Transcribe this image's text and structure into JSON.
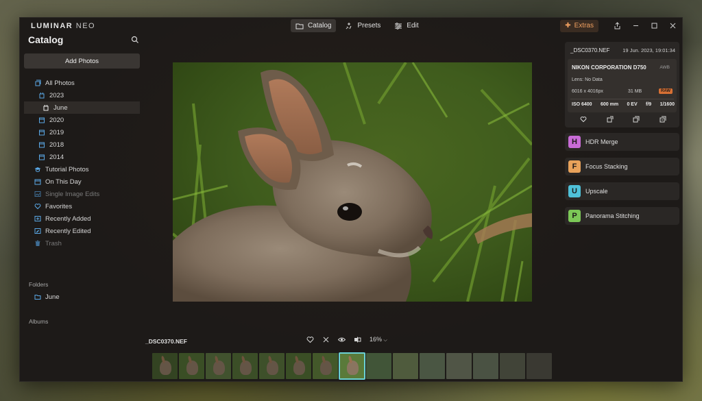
{
  "app": {
    "logo_main": "LUMINAR",
    "logo_sub": "NEO"
  },
  "modes": [
    {
      "label": "Catalog",
      "icon": "folder-icon",
      "active": true
    },
    {
      "label": "Presets",
      "icon": "sparkle-icon",
      "active": false
    },
    {
      "label": "Edit",
      "icon": "sliders-icon",
      "active": false
    }
  ],
  "window_controls": {
    "extras_label": "Extras"
  },
  "sidebar": {
    "title": "Catalog",
    "add_photos_label": "Add Photos",
    "items": [
      {
        "label": "All Photos",
        "icon": "photo-icon"
      },
      {
        "label": "2023",
        "icon": "calendar-folder-icon"
      },
      {
        "label": "June",
        "icon": "calendar-folder-icon"
      },
      {
        "label": "2020",
        "icon": "calendar-icon"
      },
      {
        "label": "2019",
        "icon": "calendar-icon"
      },
      {
        "label": "2018",
        "icon": "calendar-icon"
      },
      {
        "label": "2014",
        "icon": "calendar-icon"
      },
      {
        "label": "Tutorial Photos",
        "icon": "graduation-cap-icon"
      },
      {
        "label": "On This Day",
        "icon": "calendar-icon"
      },
      {
        "label": "Single Image Edits",
        "icon": "image-edit-icon"
      },
      {
        "label": "Favorites",
        "icon": "heart-icon"
      },
      {
        "label": "Recently Added",
        "icon": "recent-icon"
      },
      {
        "label": "Recently Edited",
        "icon": "recent-icon"
      },
      {
        "label": "Trash",
        "icon": "trash-icon"
      }
    ],
    "folders_label": "Folders",
    "folders": [
      {
        "label": "June",
        "icon": "folder-icon"
      }
    ],
    "albums_label": "Albums"
  },
  "viewer": {
    "filename": "_DSC0370.NEF",
    "zoom": "16%"
  },
  "info_panel": {
    "filename": "_DSC0370.NEF",
    "datetime": "19 Jun. 2023, 19:01:34",
    "camera": "NIKON CORPORATION D750",
    "white_balance": "AWB",
    "lens": "Lens: No Data",
    "resolution": "6016 x 4016px",
    "file_size": "31 MB",
    "format_badge": "RAW",
    "iso": "ISO 6400",
    "focal_length": "600 mm",
    "exposure_comp": "0 EV",
    "aperture": "f/9",
    "shutter": "1/1600"
  },
  "extensions": [
    {
      "letter": "H",
      "label": "HDR Merge",
      "color": "#c86bd6"
    },
    {
      "letter": "F",
      "label": "Focus Stacking",
      "color": "#e8a25a"
    },
    {
      "letter": "U",
      "label": "Upscale",
      "color": "#4fc1d8"
    },
    {
      "letter": "P",
      "label": "Panorama Stitching",
      "color": "#7cc857"
    }
  ],
  "filmstrip": {
    "count": 15,
    "active_index": 7
  }
}
